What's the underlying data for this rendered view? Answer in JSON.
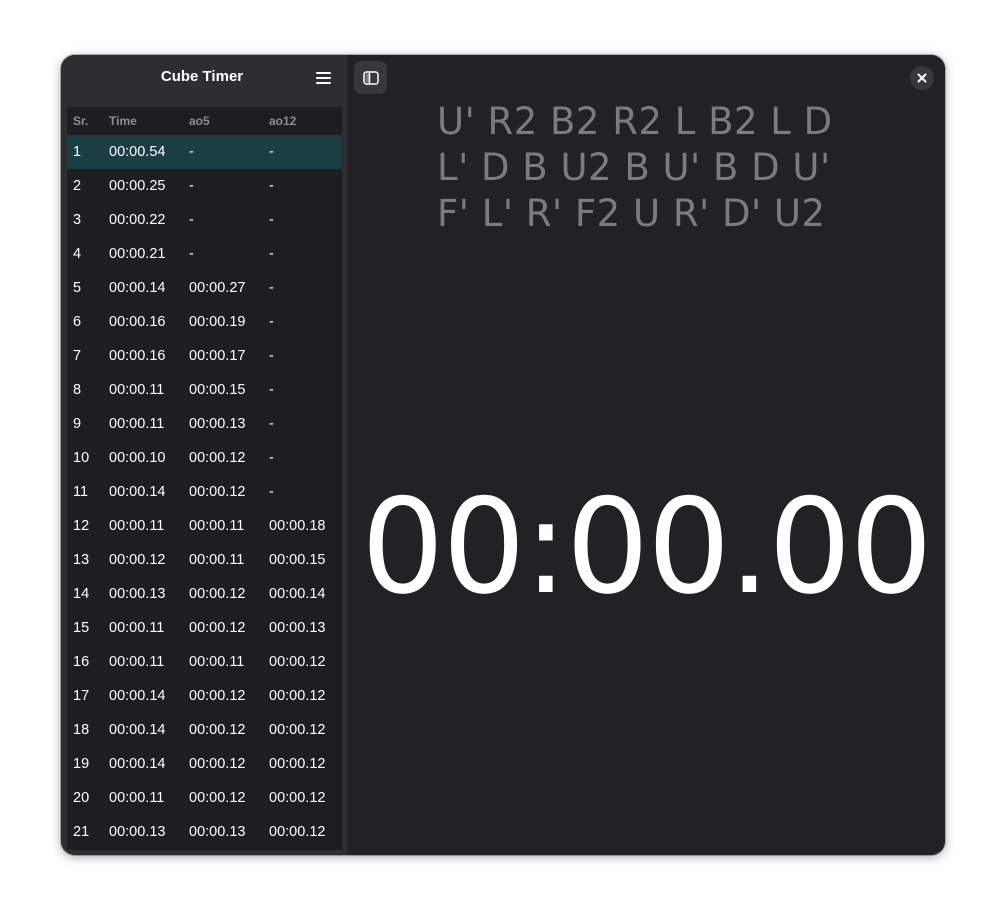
{
  "sidebar": {
    "title": "Cube Timer",
    "menu_icon": "hamburger-menu-icon"
  },
  "solves_table": {
    "headers": {
      "sr": "Sr.",
      "time": "Time",
      "ao5": "ao5",
      "ao12": "ao12"
    },
    "selected_row": 1,
    "rows": [
      {
        "sr": "1",
        "time": "00:00.54",
        "ao5": "-",
        "ao12": "-"
      },
      {
        "sr": "2",
        "time": "00:00.25",
        "ao5": "-",
        "ao12": "-"
      },
      {
        "sr": "3",
        "time": "00:00.22",
        "ao5": "-",
        "ao12": "-"
      },
      {
        "sr": "4",
        "time": "00:00.21",
        "ao5": "-",
        "ao12": "-"
      },
      {
        "sr": "5",
        "time": "00:00.14",
        "ao5": "00:00.27",
        "ao12": "-"
      },
      {
        "sr": "6",
        "time": "00:00.16",
        "ao5": "00:00.19",
        "ao12": "-"
      },
      {
        "sr": "7",
        "time": "00:00.16",
        "ao5": "00:00.17",
        "ao12": "-"
      },
      {
        "sr": "8",
        "time": "00:00.11",
        "ao5": "00:00.15",
        "ao12": "-"
      },
      {
        "sr": "9",
        "time": "00:00.11",
        "ao5": "00:00.13",
        "ao12": "-"
      },
      {
        "sr": "10",
        "time": "00:00.10",
        "ao5": "00:00.12",
        "ao12": "-"
      },
      {
        "sr": "11",
        "time": "00:00.14",
        "ao5": "00:00.12",
        "ao12": "-"
      },
      {
        "sr": "12",
        "time": "00:00.11",
        "ao5": "00:00.11",
        "ao12": "00:00.18"
      },
      {
        "sr": "13",
        "time": "00:00.12",
        "ao5": "00:00.11",
        "ao12": "00:00.15"
      },
      {
        "sr": "14",
        "time": "00:00.13",
        "ao5": "00:00.12",
        "ao12": "00:00.14"
      },
      {
        "sr": "15",
        "time": "00:00.11",
        "ao5": "00:00.12",
        "ao12": "00:00.13"
      },
      {
        "sr": "16",
        "time": "00:00.11",
        "ao5": "00:00.11",
        "ao12": "00:00.12"
      },
      {
        "sr": "17",
        "time": "00:00.14",
        "ao5": "00:00.12",
        "ao12": "00:00.12"
      },
      {
        "sr": "18",
        "time": "00:00.14",
        "ao5": "00:00.12",
        "ao12": "00:00.12"
      },
      {
        "sr": "19",
        "time": "00:00.14",
        "ao5": "00:00.12",
        "ao12": "00:00.12"
      },
      {
        "sr": "20",
        "time": "00:00.11",
        "ao5": "00:00.12",
        "ao12": "00:00.12"
      },
      {
        "sr": "21",
        "time": "00:00.13",
        "ao5": "00:00.13",
        "ao12": "00:00.12"
      }
    ]
  },
  "main": {
    "sidebar_toggle_icon": "sidebar-toggle-icon",
    "close_icon": "close-icon",
    "scramble_lines": [
      "U' R2 B2 R2 L B2 L D",
      "L' D B U2 B U' B D U'",
      "F' L' R' F2 U R' D' U2"
    ],
    "timer": "00:00.00"
  },
  "colors": {
    "window_bg": "#222226",
    "sidebar_bg": "#2e2e32",
    "table_bg": "#1e1e21",
    "selected_row_bg": "#1b3e45",
    "scramble_text": "#7c7c80",
    "header_text": "#8e8e93"
  }
}
